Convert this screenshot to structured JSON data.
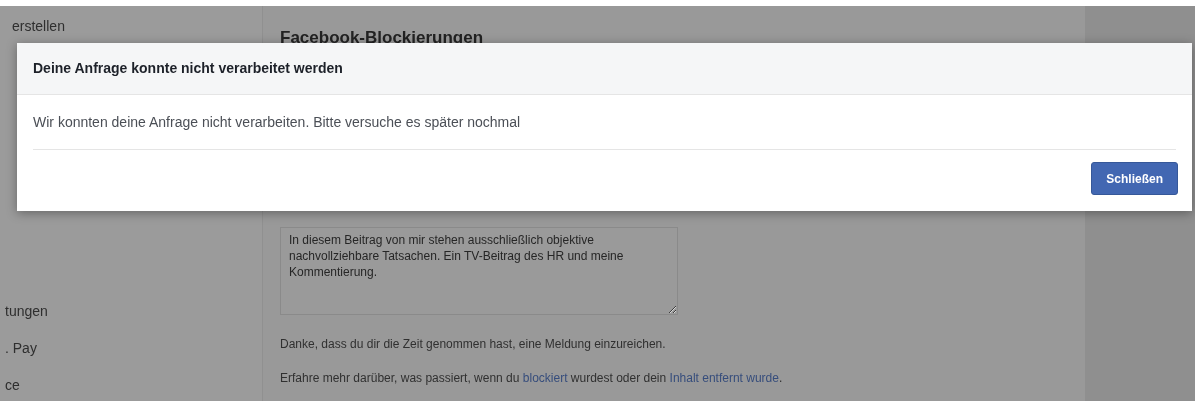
{
  "sidebar": {
    "items": [
      "erstellen",
      "tungen",
      ". Pay",
      "ce"
    ]
  },
  "main": {
    "heading": "Facebook-Blockierungen",
    "explanation": "In diesem Beitrag von mir stehen ausschließlich objektive nachvollziehbare Tatsachen. Ein TV-Beitrag des HR und meine Kommentierung.",
    "thanks": "Danke, dass du dir die Zeit genommen hast, eine Meldung einzureichen.",
    "learn_more": {
      "before": "Erfahre mehr darüber, was passiert, wenn du ",
      "link_1": "blockiert",
      "middle": " wurdest oder dein ",
      "link_2": "Inhalt entfernt wurde",
      "after": "."
    }
  },
  "dialog": {
    "title": "Deine Anfrage konnte nicht verarbeitet werden",
    "message": "Wir konnten deine Anfrage nicht verarbeiten. Bitte versuche es später nochmal",
    "buttons": [
      "Schließen"
    ]
  }
}
